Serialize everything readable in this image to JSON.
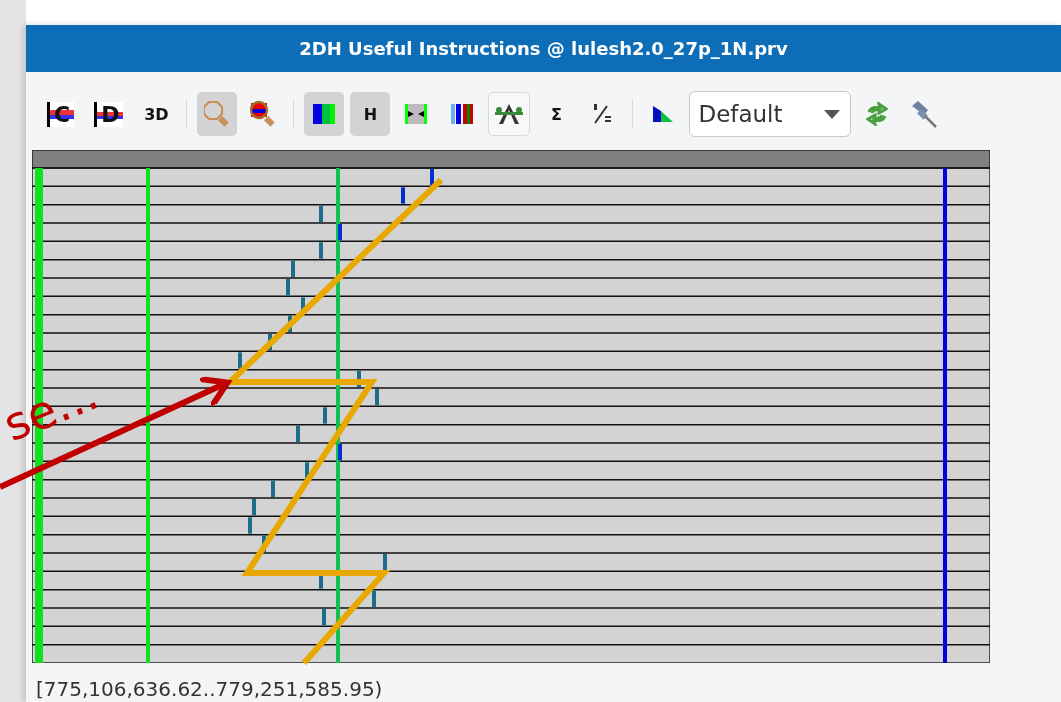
{
  "window": {
    "title": "2DH Useful Instructions @ lulesh2.0_27p_1N.prv"
  },
  "toolbar": {
    "buttons": [
      {
        "kind": "c-bars",
        "label": "C",
        "pressed": false,
        "highlighted": false
      },
      {
        "kind": "d-bars",
        "label": "D",
        "pressed": false,
        "highlighted": false
      },
      {
        "kind": "text",
        "label": "3D",
        "pressed": false,
        "highlighted": false
      },
      {
        "kind": "separator"
      },
      {
        "kind": "zoom",
        "pressed": true,
        "highlighted": false
      },
      {
        "kind": "zoom-color",
        "pressed": false,
        "highlighted": false
      },
      {
        "kind": "separator"
      },
      {
        "kind": "color-bars",
        "pressed": true,
        "highlighted": false
      },
      {
        "kind": "text",
        "label": "H",
        "pressed": true,
        "highlighted": false
      },
      {
        "kind": "squeeze",
        "pressed": false,
        "highlighted": false
      },
      {
        "kind": "color-bars-2",
        "pressed": false,
        "highlighted": false
      },
      {
        "kind": "tree",
        "pressed": false,
        "highlighted": true
      },
      {
        "kind": "text",
        "label": "Σ",
        "pressed": false,
        "highlighted": false
      },
      {
        "kind": "fraction",
        "pressed": false,
        "highlighted": false
      },
      {
        "kind": "separator"
      },
      {
        "kind": "gradient",
        "pressed": false,
        "highlighted": false
      },
      {
        "kind": "dropdown",
        "value": "Default"
      },
      {
        "kind": "sync",
        "pressed": false,
        "highlighted": false
      },
      {
        "kind": "pin",
        "pressed": false,
        "highlighted": false
      }
    ]
  },
  "status_bar": {
    "text": "[775,106,636.62..779,251,585.95)"
  },
  "annotation": {
    "text": "se..."
  }
}
